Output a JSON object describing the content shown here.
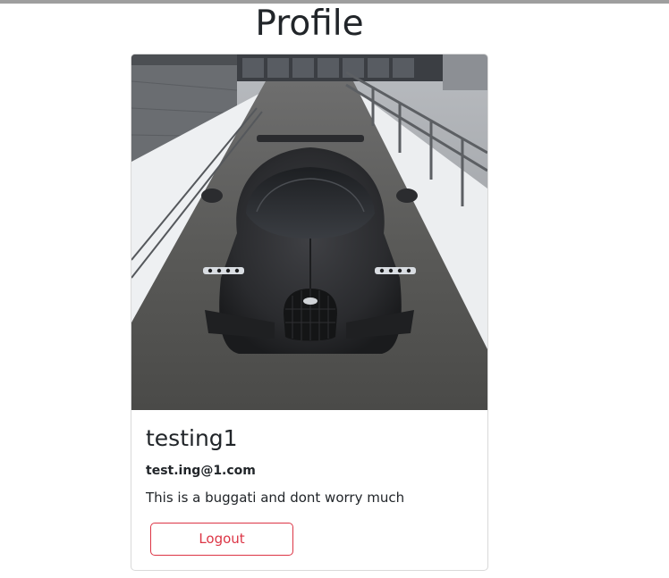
{
  "page": {
    "title": "Profile"
  },
  "profile_card": {
    "image_icon": "car-photo",
    "name": "testing1",
    "email": "test.ing@1.com",
    "bio": "This is a buggati and dont worry much",
    "logout_label": "Logout"
  },
  "colors": {
    "logout_accent": "#dc3545",
    "top_bar": "#9e9e9e",
    "card_border": "#d9d9d9"
  }
}
